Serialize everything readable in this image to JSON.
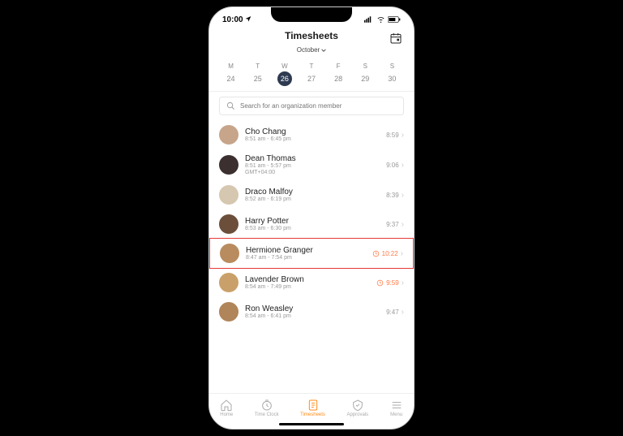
{
  "statusbar": {
    "time": "10:00"
  },
  "header": {
    "title": "Timesheets",
    "month": "October"
  },
  "week": {
    "days": [
      {
        "letter": "M",
        "num": "24",
        "selected": false
      },
      {
        "letter": "T",
        "num": "25",
        "selected": false
      },
      {
        "letter": "W",
        "num": "26",
        "selected": true
      },
      {
        "letter": "T",
        "num": "27",
        "selected": false
      },
      {
        "letter": "F",
        "num": "28",
        "selected": false
      },
      {
        "letter": "S",
        "num": "29",
        "selected": false
      },
      {
        "letter": "S",
        "num": "30",
        "selected": false
      }
    ]
  },
  "search": {
    "placeholder": "Search for an organization member"
  },
  "members": [
    {
      "name": "Cho Chang",
      "sub": "8:51 am - 6:45 pm",
      "sub2": "",
      "value": "8:59",
      "warn": false,
      "hl": false,
      "avatar_bg": "#c7a58a"
    },
    {
      "name": "Dean Thomas",
      "sub": "8:51 am - 5:57 pm",
      "sub2": "GMT+04:00",
      "value": "9:06",
      "warn": false,
      "hl": false,
      "avatar_bg": "#3b2f2f"
    },
    {
      "name": "Draco Malfoy",
      "sub": "8:52 am - 6:19 pm",
      "sub2": "",
      "value": "8:39",
      "warn": false,
      "hl": false,
      "avatar_bg": "#d6c7b0"
    },
    {
      "name": "Harry Potter",
      "sub": "8:53 am - 6:30 pm",
      "sub2": "",
      "value": "9:37",
      "warn": false,
      "hl": false,
      "avatar_bg": "#6b4f3b"
    },
    {
      "name": "Hermione Granger",
      "sub": "8:47 am - 7:54 pm",
      "sub2": "",
      "value": "10:22",
      "warn": true,
      "hl": true,
      "avatar_bg": "#b88c5e"
    },
    {
      "name": "Lavender Brown",
      "sub": "8:54 am - 7:49 pm",
      "sub2": "",
      "value": "9:59",
      "warn": true,
      "hl": false,
      "avatar_bg": "#caa06a"
    },
    {
      "name": "Ron Weasley",
      "sub": "8:54 am - 6:41 pm",
      "sub2": "",
      "value": "9:47",
      "warn": false,
      "hl": false,
      "avatar_bg": "#b0855a"
    }
  ],
  "tabs": [
    {
      "label": "Home",
      "active": false
    },
    {
      "label": "Time Clock",
      "active": false
    },
    {
      "label": "Timesheets",
      "active": true
    },
    {
      "label": "Approvals",
      "active": false
    },
    {
      "label": "Menu",
      "active": false
    }
  ]
}
